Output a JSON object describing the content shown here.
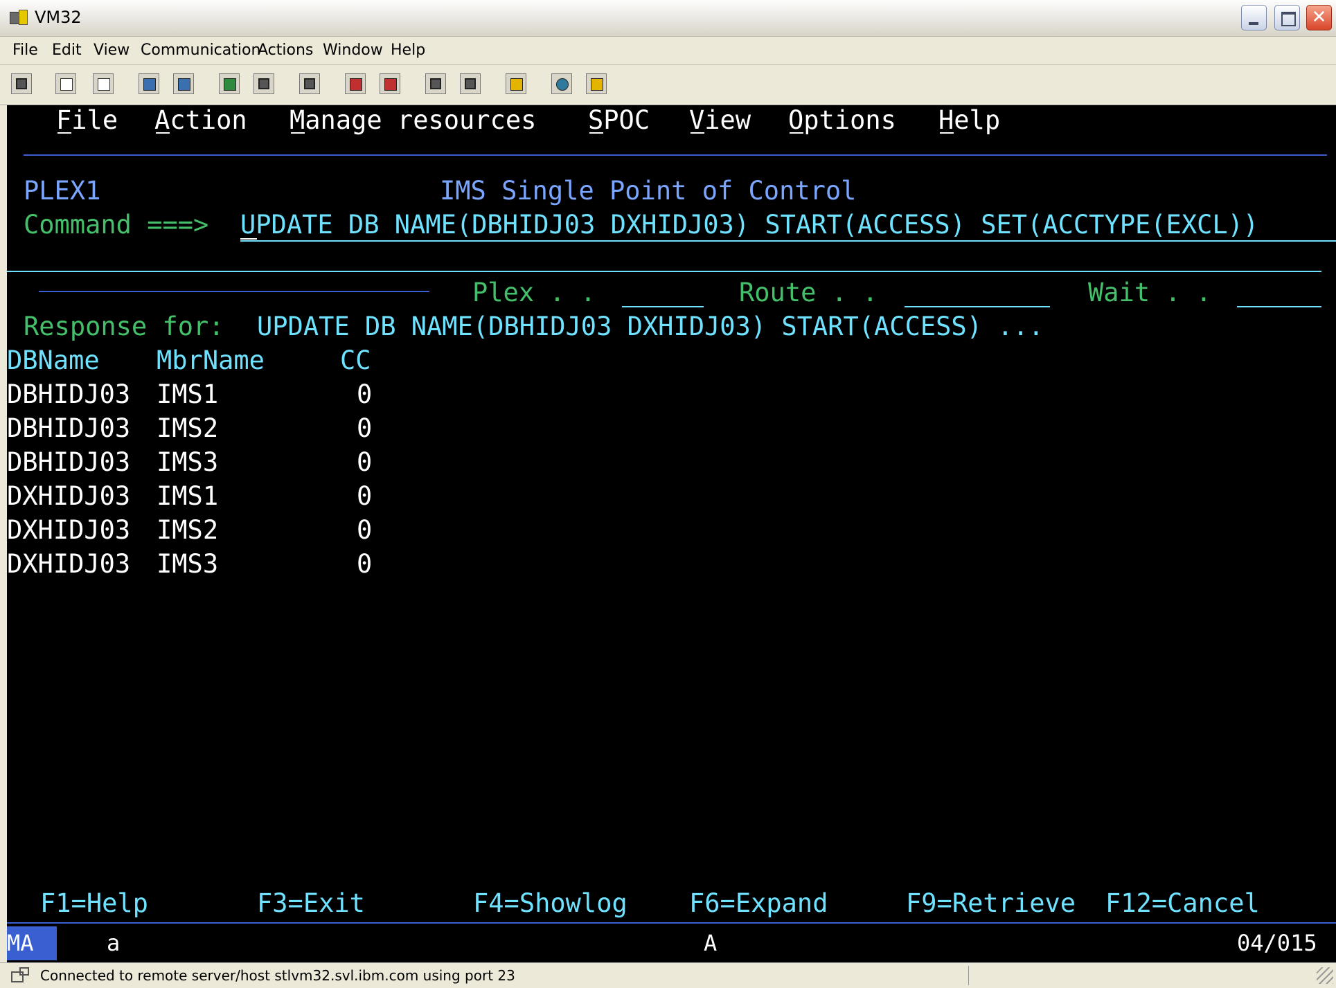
{
  "window": {
    "title": "VM32"
  },
  "menubar": {
    "items": [
      "File",
      "Edit",
      "View",
      "Communication",
      "Actions",
      "Window",
      "Help"
    ]
  },
  "toolbar": {
    "icons": [
      "display-icon",
      "copy-icon",
      "paste-icon",
      "send-file-icon",
      "receive-file-icon",
      "keypad-icon",
      "screen-icon",
      "keyboard-map-icon",
      "macro-play-icon",
      "macro-record-icon",
      "host-connect-icon",
      "host-disconnect-icon",
      "clipboard-icon",
      "globe-icon",
      "edit-icon"
    ]
  },
  "terminal": {
    "action_bar": [
      "File",
      "Action",
      "Manage resources",
      "SPOC",
      "View",
      "Options",
      "Help"
    ],
    "plex": "PLEX1",
    "panel_title": "IMS Single Point of Control",
    "command_label": "Command ===>",
    "command_value": "UPDATE DB NAME(DBHIDJ03 DXHIDJ03) START(ACCESS) SET(ACCTYPE(EXCL))",
    "plex_label": "Plex . .",
    "route_label": "Route . .",
    "wait_label": "Wait . .",
    "response_label": "Response for:",
    "response_value": "UPDATE DB NAME(DBHIDJ03 DXHIDJ03) START(ACCESS) ...",
    "columns": [
      "DBName",
      "MbrName",
      "CC"
    ],
    "rows": [
      {
        "dbname": "DBHIDJ03",
        "mbrname": "IMS1",
        "cc": "0"
      },
      {
        "dbname": "DBHIDJ03",
        "mbrname": "IMS2",
        "cc": "0"
      },
      {
        "dbname": "DBHIDJ03",
        "mbrname": "IMS3",
        "cc": "0"
      },
      {
        "dbname": "DXHIDJ03",
        "mbrname": "IMS1",
        "cc": "0"
      },
      {
        "dbname": "DXHIDJ03",
        "mbrname": "IMS2",
        "cc": "0"
      },
      {
        "dbname": "DXHIDJ03",
        "mbrname": "IMS3",
        "cc": "0"
      }
    ],
    "fkeys": [
      "F1=Help",
      "F3=Exit",
      "F4=Showlog",
      "F6=Expand",
      "F9=Retrieve",
      "F12=Cancel"
    ],
    "oia": {
      "mode": "MA",
      "indicator": "a",
      "kbd": "A",
      "cursor": "04/015"
    }
  },
  "statusbar": {
    "text": "Connected to remote server/host stlvm32.svl.ibm.com using port 23"
  }
}
